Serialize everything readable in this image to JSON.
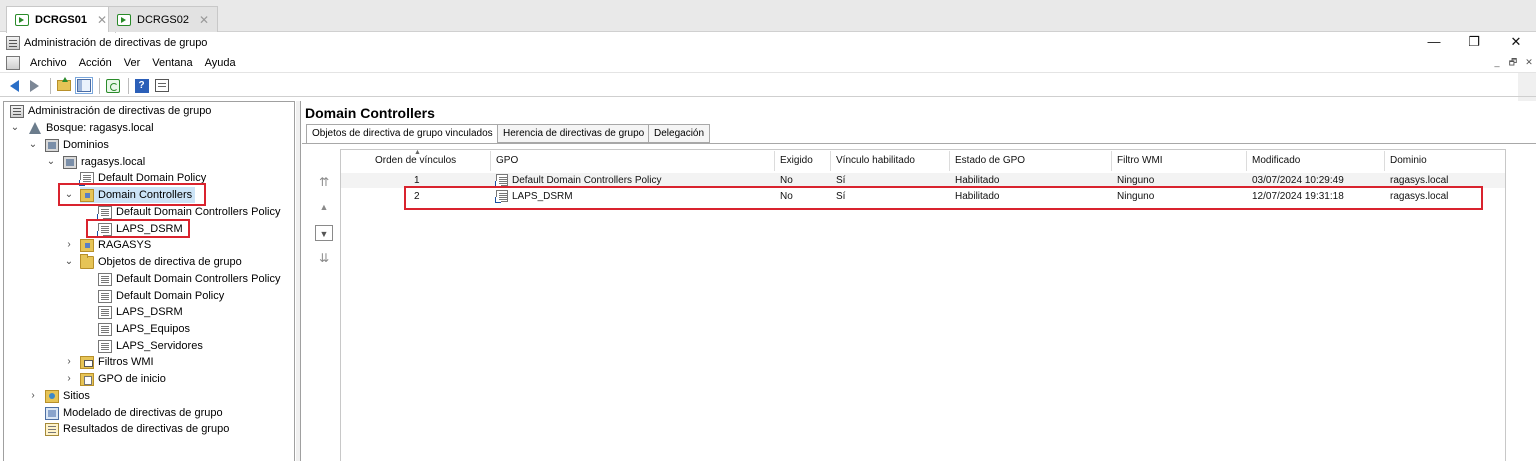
{
  "vm_tabs": [
    {
      "label": "DCRGS01",
      "close": "✕"
    },
    {
      "label": "DCRGS02",
      "close": "✕"
    }
  ],
  "window": {
    "title": "Administración de directivas de grupo",
    "minimize": "—",
    "restore": "❐",
    "close": "✕"
  },
  "menu": {
    "items": [
      "Archivo",
      "Acción",
      "Ver",
      "Ventana",
      "Ayuda"
    ],
    "mdi": [
      "_",
      "🗗",
      "✕"
    ]
  },
  "toolbar": {
    "buttons": [
      "back-icon",
      "forward-icon",
      "up-folder-icon",
      "show-hide-tree-icon",
      "refresh-icon",
      "help-icon",
      "properties-icon"
    ]
  },
  "tree": {
    "root": "Administración de directivas de grupo",
    "forest": "Bosque: ragasys.local",
    "domains": "Dominios",
    "domain": "ragasys.local",
    "default_domain_policy": "Default Domain Policy",
    "domain_controllers": "Domain Controllers",
    "dc_policy": "Default Domain Controllers Policy",
    "laps_dsrm": "LAPS_DSRM",
    "ragasys_ou": "RAGASYS",
    "gpo_objects": "Objetos de directiva de grupo",
    "gpo_items": [
      "Default Domain Controllers Policy",
      "Default Domain Policy",
      "LAPS_DSRM",
      "LAPS_Equipos",
      "LAPS_Servidores"
    ],
    "wmi_filters": "Filtros WMI",
    "starter_gpos": "GPO de inicio",
    "sites": "Sitios",
    "modeling": "Modelado de directivas de grupo",
    "results": "Resultados de directivas de grupo"
  },
  "right": {
    "title": "Domain Controllers",
    "tabs": [
      "Objetos de directiva de grupo vinculados",
      "Herencia de directivas de grupo",
      "Delegación"
    ],
    "columns": [
      "Orden de vínculos",
      "GPO",
      "Exigido",
      "Vínculo habilitado",
      "Estado de GPO",
      "Filtro WMI",
      "Modificado",
      "Dominio"
    ],
    "rows": [
      {
        "order": "1",
        "gpo": "Default Domain Controllers Policy",
        "enforced": "No",
        "enabled": "Sí",
        "status": "Habilitado",
        "wmi": "Ninguno",
        "modified": "03/07/2024 10:29:49",
        "domain": "ragasys.local"
      },
      {
        "order": "2",
        "gpo": "LAPS_DSRM",
        "enforced": "No",
        "enabled": "Sí",
        "status": "Habilitado",
        "wmi": "Ninguno",
        "modified": "12/07/2024 19:31:18",
        "domain": "ragasys.local"
      }
    ],
    "move_buttons": [
      "⇈",
      "▲",
      "▼",
      "⇊"
    ]
  },
  "colors": {
    "highlight_box": "#d9232e",
    "folder": "#e6c456",
    "accent_blue": "#2b6fc7"
  }
}
